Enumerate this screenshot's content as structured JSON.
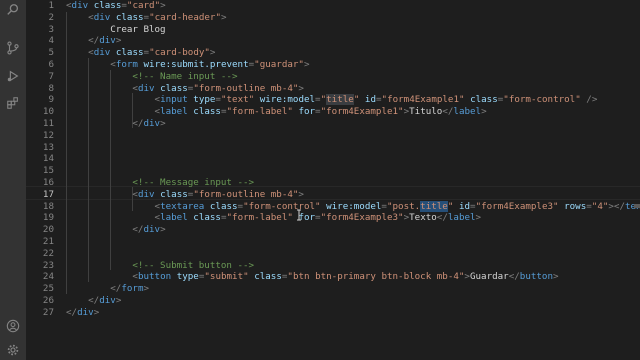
{
  "activity_bar": {
    "icons": [
      "search-icon",
      "source-control-icon",
      "run-debug-icon",
      "extensions-icon",
      "account-icon",
      "settings-gear-icon"
    ]
  },
  "editor": {
    "active_line": 17,
    "lines": [
      {
        "n": "1",
        "tokens": [
          [
            "p",
            "<"
          ],
          [
            "t",
            "div"
          ],
          [
            "s",
            " "
          ],
          [
            "a",
            "class"
          ],
          [
            "p",
            "="
          ],
          [
            "v",
            "\"card\""
          ],
          [
            "p",
            ">"
          ]
        ]
      },
      {
        "n": "2",
        "tokens": [
          [
            "s",
            "    "
          ],
          [
            "p",
            "<"
          ],
          [
            "t",
            "div"
          ],
          [
            "s",
            " "
          ],
          [
            "a",
            "class"
          ],
          [
            "p",
            "="
          ],
          [
            "v",
            "\"card-header\""
          ],
          [
            "p",
            ">"
          ]
        ]
      },
      {
        "n": "3",
        "tokens": [
          [
            "s",
            "        Crear Blog"
          ]
        ]
      },
      {
        "n": "4",
        "tokens": [
          [
            "s",
            "    "
          ],
          [
            "p",
            "</"
          ],
          [
            "t",
            "div"
          ],
          [
            "p",
            ">"
          ]
        ]
      },
      {
        "n": "5",
        "tokens": [
          [
            "s",
            "    "
          ],
          [
            "p",
            "<"
          ],
          [
            "t",
            "div"
          ],
          [
            "s",
            " "
          ],
          [
            "a",
            "class"
          ],
          [
            "p",
            "="
          ],
          [
            "v",
            "\"card-body\""
          ],
          [
            "p",
            ">"
          ]
        ]
      },
      {
        "n": "6",
        "tokens": [
          [
            "s",
            "        "
          ],
          [
            "p",
            "<"
          ],
          [
            "t",
            "form"
          ],
          [
            "s",
            " "
          ],
          [
            "a",
            "wire:submit.prevent"
          ],
          [
            "p",
            "="
          ],
          [
            "v",
            "\"guardar\""
          ],
          [
            "p",
            ">"
          ]
        ]
      },
      {
        "n": "7",
        "tokens": [
          [
            "s",
            "            "
          ],
          [
            "c",
            "<!-- Name input -->"
          ]
        ]
      },
      {
        "n": "8",
        "tokens": [
          [
            "s",
            "            "
          ],
          [
            "p",
            "<"
          ],
          [
            "t",
            "div"
          ],
          [
            "s",
            " "
          ],
          [
            "a",
            "class"
          ],
          [
            "p",
            "="
          ],
          [
            "v",
            "\"form-outline mb-4\""
          ],
          [
            "p",
            ">"
          ]
        ]
      },
      {
        "n": "9",
        "tokens": [
          [
            "s",
            "                "
          ],
          [
            "p",
            "<"
          ],
          [
            "t",
            "input"
          ],
          [
            "s",
            " "
          ],
          [
            "a",
            "type"
          ],
          [
            "p",
            "="
          ],
          [
            "v",
            "\"text\""
          ],
          [
            "s",
            " "
          ],
          [
            "a",
            "wire:model"
          ],
          [
            "p",
            "="
          ],
          [
            "v",
            "\""
          ],
          [
            "vh",
            "title"
          ],
          [
            "v",
            "\""
          ],
          [
            "s",
            " "
          ],
          [
            "a",
            "id"
          ],
          [
            "p",
            "="
          ],
          [
            "v",
            "\"form4Example1\""
          ],
          [
            "s",
            " "
          ],
          [
            "a",
            "class"
          ],
          [
            "p",
            "="
          ],
          [
            "v",
            "\"form-control\""
          ],
          [
            "s",
            " "
          ],
          [
            "p",
            "/>"
          ]
        ]
      },
      {
        "n": "10",
        "tokens": [
          [
            "s",
            "                "
          ],
          [
            "p",
            "<"
          ],
          [
            "t",
            "label"
          ],
          [
            "s",
            " "
          ],
          [
            "a",
            "class"
          ],
          [
            "p",
            "="
          ],
          [
            "v",
            "\"form-label\""
          ],
          [
            "s",
            " "
          ],
          [
            "a",
            "for"
          ],
          [
            "p",
            "="
          ],
          [
            "v",
            "\"form4Example1\""
          ],
          [
            "p",
            ">"
          ],
          [
            "s",
            "Titulo"
          ],
          [
            "p",
            "</"
          ],
          [
            "t",
            "label"
          ],
          [
            "p",
            ">"
          ]
        ]
      },
      {
        "n": "11",
        "tokens": [
          [
            "s",
            "            "
          ],
          [
            "p",
            "</"
          ],
          [
            "t",
            "div"
          ],
          [
            "p",
            ">"
          ]
        ]
      },
      {
        "n": "12",
        "tokens": []
      },
      {
        "n": "13",
        "tokens": []
      },
      {
        "n": "14",
        "tokens": []
      },
      {
        "n": "15",
        "tokens": []
      },
      {
        "n": "16",
        "tokens": [
          [
            "s",
            "            "
          ],
          [
            "c",
            "<!-- Message input -->"
          ]
        ]
      },
      {
        "n": "17",
        "tokens": [
          [
            "s",
            "            "
          ],
          [
            "p",
            "<"
          ],
          [
            "t",
            "div"
          ],
          [
            "s",
            " "
          ],
          [
            "a",
            "class"
          ],
          [
            "p",
            "="
          ],
          [
            "v",
            "\"form-outline mb-4\""
          ],
          [
            "p",
            ">"
          ]
        ]
      },
      {
        "n": "18",
        "tokens": [
          [
            "s",
            "                "
          ],
          [
            "p",
            "<"
          ],
          [
            "t",
            "textarea"
          ],
          [
            "s",
            " "
          ],
          [
            "a",
            "class"
          ],
          [
            "p",
            "="
          ],
          [
            "v",
            "\"form-control\""
          ],
          [
            "s",
            " "
          ],
          [
            "a",
            "wire:model"
          ],
          [
            "p",
            "="
          ],
          [
            "v",
            "\"post."
          ],
          [
            "vs",
            "title"
          ],
          [
            "v",
            "\""
          ],
          [
            "s",
            " "
          ],
          [
            "a",
            "id"
          ],
          [
            "p",
            "="
          ],
          [
            "v",
            "\"form4Example3\""
          ],
          [
            "s",
            " "
          ],
          [
            "a",
            "rows"
          ],
          [
            "p",
            "="
          ],
          [
            "v",
            "\"4\""
          ],
          [
            "p",
            "></"
          ],
          [
            "t",
            "textare"
          ]
        ]
      },
      {
        "n": "19",
        "tokens": [
          [
            "s",
            "                "
          ],
          [
            "p",
            "<"
          ],
          [
            "t",
            "label"
          ],
          [
            "s",
            " "
          ],
          [
            "a",
            "class"
          ],
          [
            "p",
            "="
          ],
          [
            "v",
            "\"form-label\""
          ],
          [
            "s",
            " "
          ],
          [
            "a",
            "for"
          ],
          [
            "p",
            "="
          ],
          [
            "v",
            "\"form4Example3\""
          ],
          [
            "p",
            ">"
          ],
          [
            "s",
            "Texto"
          ],
          [
            "p",
            "</"
          ],
          [
            "t",
            "label"
          ],
          [
            "p",
            ">"
          ]
        ]
      },
      {
        "n": "20",
        "tokens": [
          [
            "s",
            "            "
          ],
          [
            "p",
            "</"
          ],
          [
            "t",
            "div"
          ],
          [
            "p",
            ">"
          ]
        ]
      },
      {
        "n": "21",
        "tokens": []
      },
      {
        "n": "22",
        "tokens": []
      },
      {
        "n": "23",
        "tokens": [
          [
            "s",
            "            "
          ],
          [
            "c",
            "<!-- Submit button -->"
          ]
        ]
      },
      {
        "n": "24",
        "tokens": [
          [
            "s",
            "            "
          ],
          [
            "p",
            "<"
          ],
          [
            "t",
            "button"
          ],
          [
            "s",
            " "
          ],
          [
            "a",
            "type"
          ],
          [
            "p",
            "="
          ],
          [
            "v",
            "\"submit\""
          ],
          [
            "s",
            " "
          ],
          [
            "a",
            "class"
          ],
          [
            "p",
            "="
          ],
          [
            "v",
            "\"btn btn-primary btn-block mb-4\""
          ],
          [
            "p",
            ">"
          ],
          [
            "s",
            "Guardar"
          ],
          [
            "p",
            "</"
          ],
          [
            "t",
            "button"
          ],
          [
            "p",
            ">"
          ]
        ]
      },
      {
        "n": "25",
        "tokens": [
          [
            "s",
            "        "
          ],
          [
            "p",
            "</"
          ],
          [
            "t",
            "form"
          ],
          [
            "p",
            ">"
          ]
        ]
      },
      {
        "n": "26",
        "tokens": [
          [
            "s",
            "    "
          ],
          [
            "p",
            "</"
          ],
          [
            "t",
            "div"
          ],
          [
            "p",
            ">"
          ]
        ]
      },
      {
        "n": "27",
        "tokens": [
          [
            "p",
            "</"
          ],
          [
            "t",
            "div"
          ],
          [
            "p",
            ">"
          ]
        ]
      }
    ]
  },
  "colors": {
    "background": "#1e1e1e",
    "activity_bar": "#333333",
    "tag": "#569cd6",
    "attribute": "#9cdcfe",
    "string": "#ce9178",
    "comment": "#6a9955",
    "line_number": "#858585"
  }
}
